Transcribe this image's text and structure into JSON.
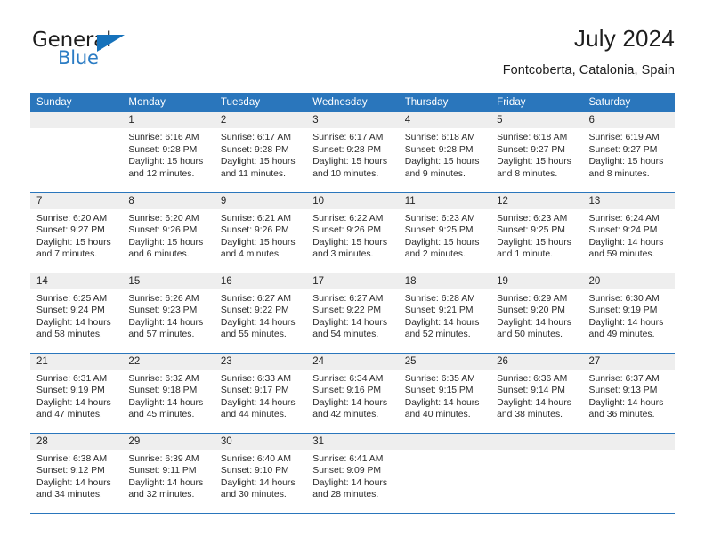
{
  "brand": {
    "name_part1": "General",
    "name_part2": "Blue",
    "triangle_color": "#1672bb",
    "blue_color": "#2b7cc4"
  },
  "header": {
    "title": "July 2024",
    "location": "Fontcoberta, Catalonia, Spain"
  },
  "theme": {
    "header_blue": "#2a76bc",
    "daynum_band": "#eeeeee",
    "cell_background": "#ffffff",
    "text": "#2b2b2b"
  },
  "weekday_headers": [
    "Sunday",
    "Monday",
    "Tuesday",
    "Wednesday",
    "Thursday",
    "Friday",
    "Saturday"
  ],
  "weeks": [
    [
      {
        "day": "",
        "sunrise": "",
        "sunset": "",
        "daylight_line1": "",
        "daylight_line2": ""
      },
      {
        "day": "1",
        "sunrise": "Sunrise: 6:16 AM",
        "sunset": "Sunset: 9:28 PM",
        "daylight_line1": "Daylight: 15 hours",
        "daylight_line2": "and 12 minutes."
      },
      {
        "day": "2",
        "sunrise": "Sunrise: 6:17 AM",
        "sunset": "Sunset: 9:28 PM",
        "daylight_line1": "Daylight: 15 hours",
        "daylight_line2": "and 11 minutes."
      },
      {
        "day": "3",
        "sunrise": "Sunrise: 6:17 AM",
        "sunset": "Sunset: 9:28 PM",
        "daylight_line1": "Daylight: 15 hours",
        "daylight_line2": "and 10 minutes."
      },
      {
        "day": "4",
        "sunrise": "Sunrise: 6:18 AM",
        "sunset": "Sunset: 9:28 PM",
        "daylight_line1": "Daylight: 15 hours",
        "daylight_line2": "and 9 minutes."
      },
      {
        "day": "5",
        "sunrise": "Sunrise: 6:18 AM",
        "sunset": "Sunset: 9:27 PM",
        "daylight_line1": "Daylight: 15 hours",
        "daylight_line2": "and 8 minutes."
      },
      {
        "day": "6",
        "sunrise": "Sunrise: 6:19 AM",
        "sunset": "Sunset: 9:27 PM",
        "daylight_line1": "Daylight: 15 hours",
        "daylight_line2": "and 8 minutes."
      }
    ],
    [
      {
        "day": "7",
        "sunrise": "Sunrise: 6:20 AM",
        "sunset": "Sunset: 9:27 PM",
        "daylight_line1": "Daylight: 15 hours",
        "daylight_line2": "and 7 minutes."
      },
      {
        "day": "8",
        "sunrise": "Sunrise: 6:20 AM",
        "sunset": "Sunset: 9:26 PM",
        "daylight_line1": "Daylight: 15 hours",
        "daylight_line2": "and 6 minutes."
      },
      {
        "day": "9",
        "sunrise": "Sunrise: 6:21 AM",
        "sunset": "Sunset: 9:26 PM",
        "daylight_line1": "Daylight: 15 hours",
        "daylight_line2": "and 4 minutes."
      },
      {
        "day": "10",
        "sunrise": "Sunrise: 6:22 AM",
        "sunset": "Sunset: 9:26 PM",
        "daylight_line1": "Daylight: 15 hours",
        "daylight_line2": "and 3 minutes."
      },
      {
        "day": "11",
        "sunrise": "Sunrise: 6:23 AM",
        "sunset": "Sunset: 9:25 PM",
        "daylight_line1": "Daylight: 15 hours",
        "daylight_line2": "and 2 minutes."
      },
      {
        "day": "12",
        "sunrise": "Sunrise: 6:23 AM",
        "sunset": "Sunset: 9:25 PM",
        "daylight_line1": "Daylight: 15 hours",
        "daylight_line2": "and 1 minute."
      },
      {
        "day": "13",
        "sunrise": "Sunrise: 6:24 AM",
        "sunset": "Sunset: 9:24 PM",
        "daylight_line1": "Daylight: 14 hours",
        "daylight_line2": "and 59 minutes."
      }
    ],
    [
      {
        "day": "14",
        "sunrise": "Sunrise: 6:25 AM",
        "sunset": "Sunset: 9:24 PM",
        "daylight_line1": "Daylight: 14 hours",
        "daylight_line2": "and 58 minutes."
      },
      {
        "day": "15",
        "sunrise": "Sunrise: 6:26 AM",
        "sunset": "Sunset: 9:23 PM",
        "daylight_line1": "Daylight: 14 hours",
        "daylight_line2": "and 57 minutes."
      },
      {
        "day": "16",
        "sunrise": "Sunrise: 6:27 AM",
        "sunset": "Sunset: 9:22 PM",
        "daylight_line1": "Daylight: 14 hours",
        "daylight_line2": "and 55 minutes."
      },
      {
        "day": "17",
        "sunrise": "Sunrise: 6:27 AM",
        "sunset": "Sunset: 9:22 PM",
        "daylight_line1": "Daylight: 14 hours",
        "daylight_line2": "and 54 minutes."
      },
      {
        "day": "18",
        "sunrise": "Sunrise: 6:28 AM",
        "sunset": "Sunset: 9:21 PM",
        "daylight_line1": "Daylight: 14 hours",
        "daylight_line2": "and 52 minutes."
      },
      {
        "day": "19",
        "sunrise": "Sunrise: 6:29 AM",
        "sunset": "Sunset: 9:20 PM",
        "daylight_line1": "Daylight: 14 hours",
        "daylight_line2": "and 50 minutes."
      },
      {
        "day": "20",
        "sunrise": "Sunrise: 6:30 AM",
        "sunset": "Sunset: 9:19 PM",
        "daylight_line1": "Daylight: 14 hours",
        "daylight_line2": "and 49 minutes."
      }
    ],
    [
      {
        "day": "21",
        "sunrise": "Sunrise: 6:31 AM",
        "sunset": "Sunset: 9:19 PM",
        "daylight_line1": "Daylight: 14 hours",
        "daylight_line2": "and 47 minutes."
      },
      {
        "day": "22",
        "sunrise": "Sunrise: 6:32 AM",
        "sunset": "Sunset: 9:18 PM",
        "daylight_line1": "Daylight: 14 hours",
        "daylight_line2": "and 45 minutes."
      },
      {
        "day": "23",
        "sunrise": "Sunrise: 6:33 AM",
        "sunset": "Sunset: 9:17 PM",
        "daylight_line1": "Daylight: 14 hours",
        "daylight_line2": "and 44 minutes."
      },
      {
        "day": "24",
        "sunrise": "Sunrise: 6:34 AM",
        "sunset": "Sunset: 9:16 PM",
        "daylight_line1": "Daylight: 14 hours",
        "daylight_line2": "and 42 minutes."
      },
      {
        "day": "25",
        "sunrise": "Sunrise: 6:35 AM",
        "sunset": "Sunset: 9:15 PM",
        "daylight_line1": "Daylight: 14 hours",
        "daylight_line2": "and 40 minutes."
      },
      {
        "day": "26",
        "sunrise": "Sunrise: 6:36 AM",
        "sunset": "Sunset: 9:14 PM",
        "daylight_line1": "Daylight: 14 hours",
        "daylight_line2": "and 38 minutes."
      },
      {
        "day": "27",
        "sunrise": "Sunrise: 6:37 AM",
        "sunset": "Sunset: 9:13 PM",
        "daylight_line1": "Daylight: 14 hours",
        "daylight_line2": "and 36 minutes."
      }
    ],
    [
      {
        "day": "28",
        "sunrise": "Sunrise: 6:38 AM",
        "sunset": "Sunset: 9:12 PM",
        "daylight_line1": "Daylight: 14 hours",
        "daylight_line2": "and 34 minutes."
      },
      {
        "day": "29",
        "sunrise": "Sunrise: 6:39 AM",
        "sunset": "Sunset: 9:11 PM",
        "daylight_line1": "Daylight: 14 hours",
        "daylight_line2": "and 32 minutes."
      },
      {
        "day": "30",
        "sunrise": "Sunrise: 6:40 AM",
        "sunset": "Sunset: 9:10 PM",
        "daylight_line1": "Daylight: 14 hours",
        "daylight_line2": "and 30 minutes."
      },
      {
        "day": "31",
        "sunrise": "Sunrise: 6:41 AM",
        "sunset": "Sunset: 9:09 PM",
        "daylight_line1": "Daylight: 14 hours",
        "daylight_line2": "and 28 minutes."
      },
      {
        "day": "",
        "sunrise": "",
        "sunset": "",
        "daylight_line1": "",
        "daylight_line2": ""
      },
      {
        "day": "",
        "sunrise": "",
        "sunset": "",
        "daylight_line1": "",
        "daylight_line2": ""
      },
      {
        "day": "",
        "sunrise": "",
        "sunset": "",
        "daylight_line1": "",
        "daylight_line2": ""
      }
    ]
  ]
}
